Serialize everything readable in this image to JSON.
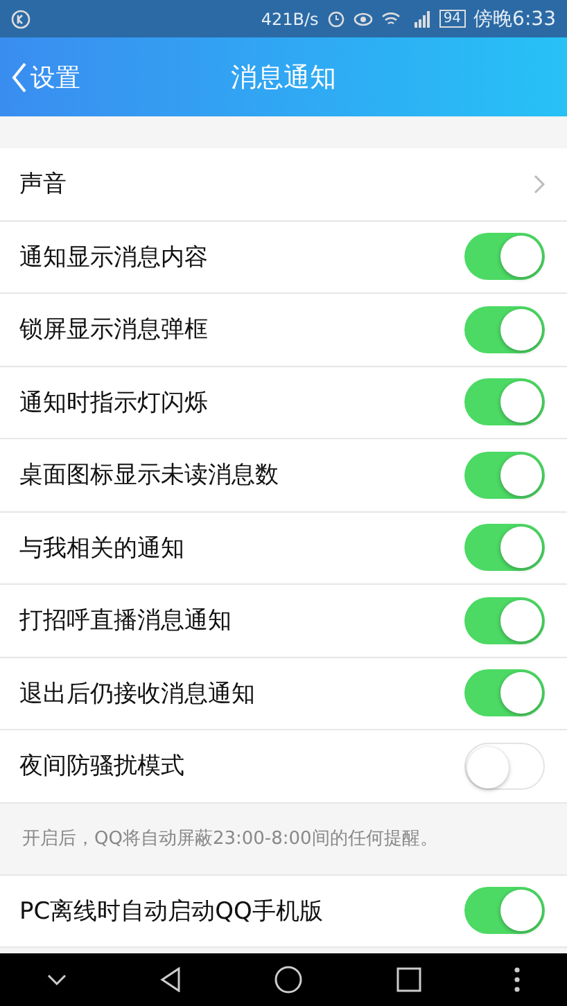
{
  "status_bar": {
    "speed": "421B/s",
    "battery": "94",
    "time": "傍晚6:33"
  },
  "header": {
    "back": "设置",
    "title": "消息通知"
  },
  "sound": {
    "label": "声音"
  },
  "toggles": [
    {
      "label": "通知显示消息内容",
      "on": true
    },
    {
      "label": "锁屏显示消息弹框",
      "on": true
    },
    {
      "label": "通知时指示灯闪烁",
      "on": true
    },
    {
      "label": "桌面图标显示未读消息数",
      "on": true
    },
    {
      "label": "与我相关的通知",
      "on": true
    },
    {
      "label": "打招呼直播消息通知",
      "on": true
    },
    {
      "label": "退出后仍接收消息通知",
      "on": true
    },
    {
      "label": "夜间防骚扰模式",
      "on": false
    }
  ],
  "note": "开启后，QQ将自动屏蔽23:00-8:00间的任何提醒。",
  "pc_toggle": {
    "label": "PC离线时自动启动QQ手机版",
    "on": true
  }
}
